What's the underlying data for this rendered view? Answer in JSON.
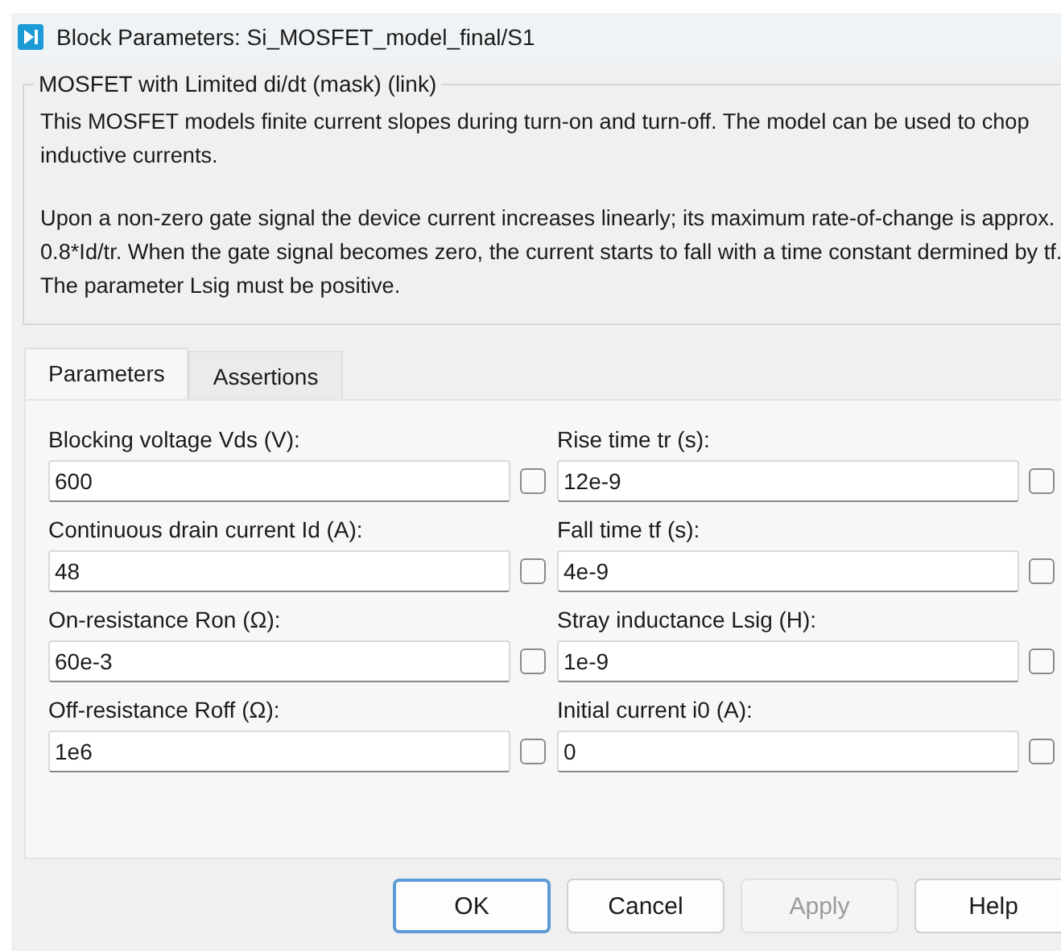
{
  "window": {
    "title": "Block Parameters: Si_MOSFET_model_final/S1"
  },
  "group": {
    "title": "MOSFET with Limited di/dt (mask) (link)",
    "paragraphs": [
      "This MOSFET models finite current slopes during turn-on and turn-off. The model can be used to chop inductive currents.",
      "Upon a non-zero gate signal the device current increases linearly; its maximum rate-of-change is approx. 0.8*Id/tr. When the gate signal becomes zero, the current starts to fall with a time constant dermined by tf. The parameter Lsig must be positive."
    ]
  },
  "tabs": [
    {
      "label": "Parameters",
      "selected": true
    },
    {
      "label": "Assertions",
      "selected": false
    }
  ],
  "parameters": [
    {
      "label": "Blocking voltage Vds (V):",
      "value": "600",
      "checked": false
    },
    {
      "label": "Rise time tr (s):",
      "value": "12e-9",
      "checked": false
    },
    {
      "label": "Continuous drain current Id (A):",
      "value": "48",
      "checked": false
    },
    {
      "label": "Fall time tf (s):",
      "value": "4e-9",
      "checked": false
    },
    {
      "label": "On-resistance Ron (Ω):",
      "value": "60e-3",
      "checked": false
    },
    {
      "label": "Stray inductance Lsig (H):",
      "value": "1e-9",
      "checked": false
    },
    {
      "label": "Off-resistance Roff (Ω):",
      "value": "1e6",
      "checked": false
    },
    {
      "label": "Initial current i0 (A):",
      "value": "0",
      "checked": false
    }
  ],
  "buttons": [
    {
      "label": "OK",
      "default": true,
      "disabled": false
    },
    {
      "label": "Cancel",
      "default": false,
      "disabled": false
    },
    {
      "label": "Apply",
      "default": false,
      "disabled": true
    },
    {
      "label": "Help",
      "default": false,
      "disabled": false
    }
  ]
}
